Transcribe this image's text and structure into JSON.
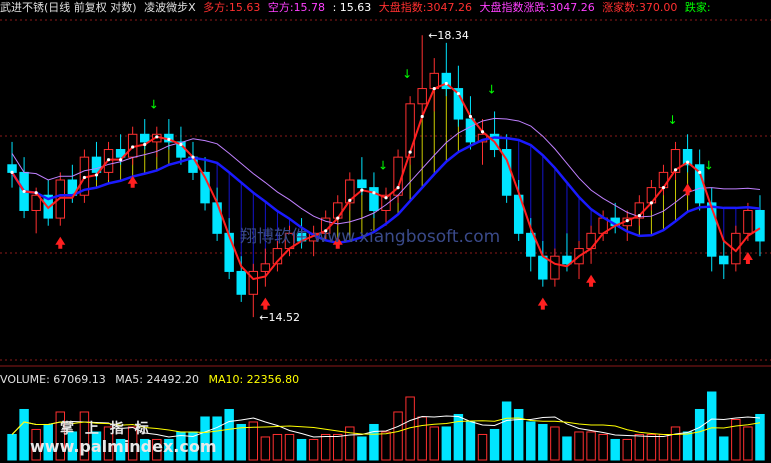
{
  "header": {
    "stock": "武进不锈(日线 前复权 对数)",
    "indicator": "凌波微步X",
    "long_label": "多方:",
    "long_value": "15.63",
    "short_label": "空方:",
    "short_value": "15.78",
    "last_value": ": 15.63",
    "index_label": "大盘指数:",
    "index_value": "3047.26",
    "index2_label": "大盘指数涨跌:",
    "index2_value": "3047.26",
    "up_label": "涨家数:",
    "up_value": "370.00",
    "down_label": "跌家:"
  },
  "volume_header": {
    "volume": "VOLUME: 67069.13",
    "ma5": "MA5: 24492.20",
    "ma10": "MA10: 22356.80"
  },
  "watermarks": {
    "cn": "翔博软件 www.xiangbosoft.com",
    "palm": "掌 上 指 标",
    "palm_url": "www.palmindex.com"
  },
  "colors": {
    "up": "#ff3030",
    "down": "#00e5ff",
    "ma_blue": "#1a1aff",
    "ma_red": "#ff2020",
    "yellow": "#ffff00",
    "grid": "#8b1a1a",
    "sell": "#00ff00",
    "buy": "#ff4040"
  },
  "chart_data": {
    "type": "candlestick",
    "high_label": "18.34",
    "low_label": "14.52",
    "y_range": [
      14.3,
      18.5
    ],
    "candles": [
      [
        16.6,
        16.9,
        16.3,
        16.5
      ],
      [
        16.5,
        16.7,
        15.9,
        16.0
      ],
      [
        16.0,
        16.3,
        15.7,
        16.2
      ],
      [
        16.2,
        16.4,
        15.8,
        15.9
      ],
      [
        15.9,
        16.5,
        15.8,
        16.4
      ],
      [
        16.4,
        16.6,
        16.1,
        16.2
      ],
      [
        16.2,
        16.8,
        16.1,
        16.7
      ],
      [
        16.7,
        16.9,
        16.4,
        16.5
      ],
      [
        16.5,
        16.9,
        16.4,
        16.8
      ],
      [
        16.8,
        17.0,
        16.6,
        16.7
      ],
      [
        16.7,
        17.1,
        16.6,
        17.0
      ],
      [
        17.0,
        17.2,
        16.8,
        16.9
      ],
      [
        16.9,
        17.1,
        16.7,
        17.0
      ],
      [
        17.0,
        17.2,
        16.8,
        16.9
      ],
      [
        16.9,
        17.1,
        16.6,
        16.7
      ],
      [
        16.7,
        16.9,
        16.4,
        16.5
      ],
      [
        16.5,
        16.7,
        16.0,
        16.1
      ],
      [
        16.1,
        16.3,
        15.6,
        15.7
      ],
      [
        15.7,
        15.9,
        15.1,
        15.2
      ],
      [
        15.2,
        15.4,
        14.8,
        14.9
      ],
      [
        14.9,
        15.3,
        14.6,
        15.2
      ],
      [
        15.2,
        15.5,
        15.0,
        15.3
      ],
      [
        15.3,
        15.6,
        15.2,
        15.5
      ],
      [
        15.5,
        15.8,
        15.4,
        15.7
      ],
      [
        15.7,
        15.9,
        15.5,
        15.6
      ],
      [
        15.6,
        15.8,
        15.4,
        15.7
      ],
      [
        15.7,
        16.0,
        15.6,
        15.9
      ],
      [
        15.9,
        16.2,
        15.8,
        16.1
      ],
      [
        16.1,
        16.5,
        16.0,
        16.4
      ],
      [
        16.4,
        16.7,
        16.2,
        16.3
      ],
      [
        16.3,
        16.5,
        15.9,
        16.0
      ],
      [
        16.0,
        16.3,
        15.8,
        16.2
      ],
      [
        16.2,
        16.8,
        16.1,
        16.7
      ],
      [
        16.7,
        17.5,
        16.6,
        17.4
      ],
      [
        17.4,
        18.3,
        17.2,
        17.6
      ],
      [
        17.6,
        18.0,
        17.3,
        17.8
      ],
      [
        17.8,
        18.2,
        17.5,
        17.6
      ],
      [
        17.6,
        17.9,
        17.1,
        17.2
      ],
      [
        17.2,
        17.5,
        16.8,
        16.9
      ],
      [
        16.9,
        17.2,
        16.6,
        17.0
      ],
      [
        17.0,
        17.3,
        16.7,
        16.8
      ],
      [
        16.8,
        17.0,
        16.1,
        16.2
      ],
      [
        16.2,
        16.4,
        15.6,
        15.7
      ],
      [
        15.7,
        15.9,
        15.2,
        15.4
      ],
      [
        15.4,
        15.6,
        15.0,
        15.1
      ],
      [
        15.1,
        15.5,
        15.0,
        15.4
      ],
      [
        15.4,
        15.7,
        15.2,
        15.3
      ],
      [
        15.3,
        15.6,
        15.1,
        15.5
      ],
      [
        15.5,
        15.8,
        15.3,
        15.7
      ],
      [
        15.7,
        16.0,
        15.6,
        15.9
      ],
      [
        15.9,
        16.1,
        15.7,
        15.8
      ],
      [
        15.8,
        16.0,
        15.6,
        15.9
      ],
      [
        15.9,
        16.2,
        15.8,
        16.1
      ],
      [
        16.1,
        16.4,
        16.0,
        16.3
      ],
      [
        16.3,
        16.6,
        16.2,
        16.5
      ],
      [
        16.5,
        16.9,
        16.4,
        16.8
      ],
      [
        16.8,
        17.0,
        16.5,
        16.6
      ],
      [
        16.6,
        16.8,
        16.0,
        16.1
      ],
      [
        16.1,
        16.3,
        15.2,
        15.4
      ],
      [
        15.4,
        15.6,
        15.1,
        15.3
      ],
      [
        15.3,
        15.8,
        15.2,
        15.7
      ],
      [
        15.7,
        16.1,
        15.6,
        16.0
      ],
      [
        16.0,
        16.2,
        15.4,
        15.6
      ]
    ]
  }
}
